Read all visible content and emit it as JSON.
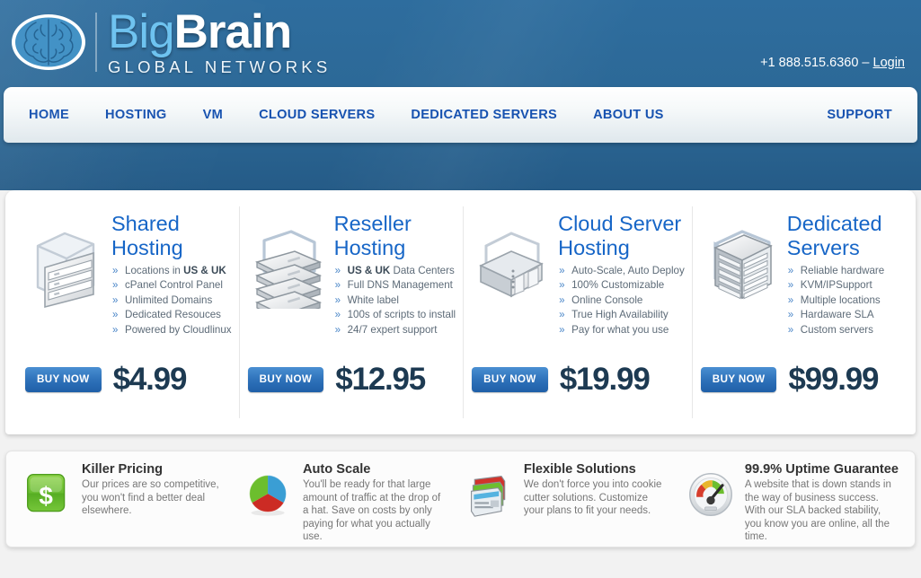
{
  "header": {
    "logo": {
      "part1": "Big",
      "part2": "Brain",
      "tagline": "GLOBAL NETWORKS",
      "icon": "brain-icon"
    },
    "contact": {
      "phone": "+1 888.515.6360",
      "separator": " – ",
      "login_label": "Login"
    }
  },
  "nav": {
    "left_items": [
      {
        "label": "HOME",
        "name": "home"
      },
      {
        "label": "HOSTING",
        "name": "hosting"
      },
      {
        "label": "VM",
        "name": "vm"
      },
      {
        "label": "CLOUD SERVERS",
        "name": "cloud-servers"
      },
      {
        "label": "DEDICATED SERVERS",
        "name": "dedicated-servers"
      },
      {
        "label": "ABOUT US",
        "name": "about-us"
      }
    ],
    "right_item": {
      "label": "SUPPORT",
      "name": "support"
    }
  },
  "plans": [
    {
      "title_line1": "Shared",
      "title_line2": "Hosting",
      "icon": "shared-server-icon",
      "features": [
        {
          "pre": "Locations in ",
          "bold": "US & UK",
          "post": ""
        },
        {
          "pre": "cPanel Control Panel",
          "bold": "",
          "post": ""
        },
        {
          "pre": "Unlimited Domains",
          "bold": "",
          "post": ""
        },
        {
          "pre": "Dedicated Resouces",
          "bold": "",
          "post": ""
        },
        {
          "pre": "Powered by Cloudlinux",
          "bold": "",
          "post": ""
        }
      ],
      "buy_label": "BUY NOW",
      "price": "$4.99"
    },
    {
      "title_line1": "Reseller",
      "title_line2": "Hosting",
      "icon": "reseller-stack-icon",
      "features": [
        {
          "pre": " ",
          "bold": "US & UK",
          "post": " Data Centers"
        },
        {
          "pre": "Full DNS Management",
          "bold": "",
          "post": ""
        },
        {
          "pre": "White label",
          "bold": "",
          "post": ""
        },
        {
          "pre": "100s of scripts to install",
          "bold": "",
          "post": ""
        },
        {
          "pre": "24/7 expert support",
          "bold": "",
          "post": ""
        }
      ],
      "buy_label": "BUY NOW",
      "price": "$12.95"
    },
    {
      "title_line1": "Cloud Server",
      "title_line2": "Hosting",
      "icon": "cloud-server-icon",
      "features": [
        {
          "pre": "Auto-Scale, Auto Deploy",
          "bold": "",
          "post": ""
        },
        {
          "pre": "100% Customizable",
          "bold": "",
          "post": ""
        },
        {
          "pre": "Online Console",
          "bold": "",
          "post": ""
        },
        {
          "pre": "True High Availability",
          "bold": "",
          "post": ""
        },
        {
          "pre": "Pay for what you use",
          "bold": "",
          "post": ""
        }
      ],
      "buy_label": "BUY NOW",
      "price": "$19.99"
    },
    {
      "title_line1": "Dedicated",
      "title_line2": "Servers",
      "icon": "dedicated-rack-icon",
      "features": [
        {
          "pre": "Reliable hardware",
          "bold": "",
          "post": ""
        },
        {
          "pre": "KVM/IPSupport",
          "bold": "",
          "post": ""
        },
        {
          "pre": "Multiple locations",
          "bold": "",
          "post": ""
        },
        {
          "pre": "Hardaware SLA",
          "bold": "",
          "post": ""
        },
        {
          "pre": "Custom servers",
          "bold": "",
          "post": ""
        }
      ],
      "buy_label": "BUY NOW",
      "price": "$99.99"
    }
  ],
  "benefits": [
    {
      "title": "Killer Pricing",
      "desc": "Our prices are so competitive, you won't find a better deal elsewhere.",
      "icon": "dollar-badge-icon"
    },
    {
      "title": "Auto Scale",
      "desc": "You'll be ready for that large amount of traffic at the drop of a hat. Save on costs by only paying for what you actually use.",
      "icon": "pie-chart-icon"
    },
    {
      "title": "Flexible Solutions",
      "desc": "We don't force you into cookie cutter solutions. Customize your plans to fit your needs.",
      "icon": "windows-stack-icon"
    },
    {
      "title": "99.9% Uptime Guarantee",
      "desc": "A website that is down stands in the way of business success. With our SLA backed stability, you know you are online, all the time.",
      "icon": "speedometer-icon"
    }
  ],
  "colors": {
    "header_blue": "#2e6d9e",
    "nav_link": "#1752b0",
    "plan_title": "#1766c7",
    "price": "#1d3a52",
    "buy_button": "#2f73bb",
    "logo_light_blue": "#6cc2f0"
  }
}
